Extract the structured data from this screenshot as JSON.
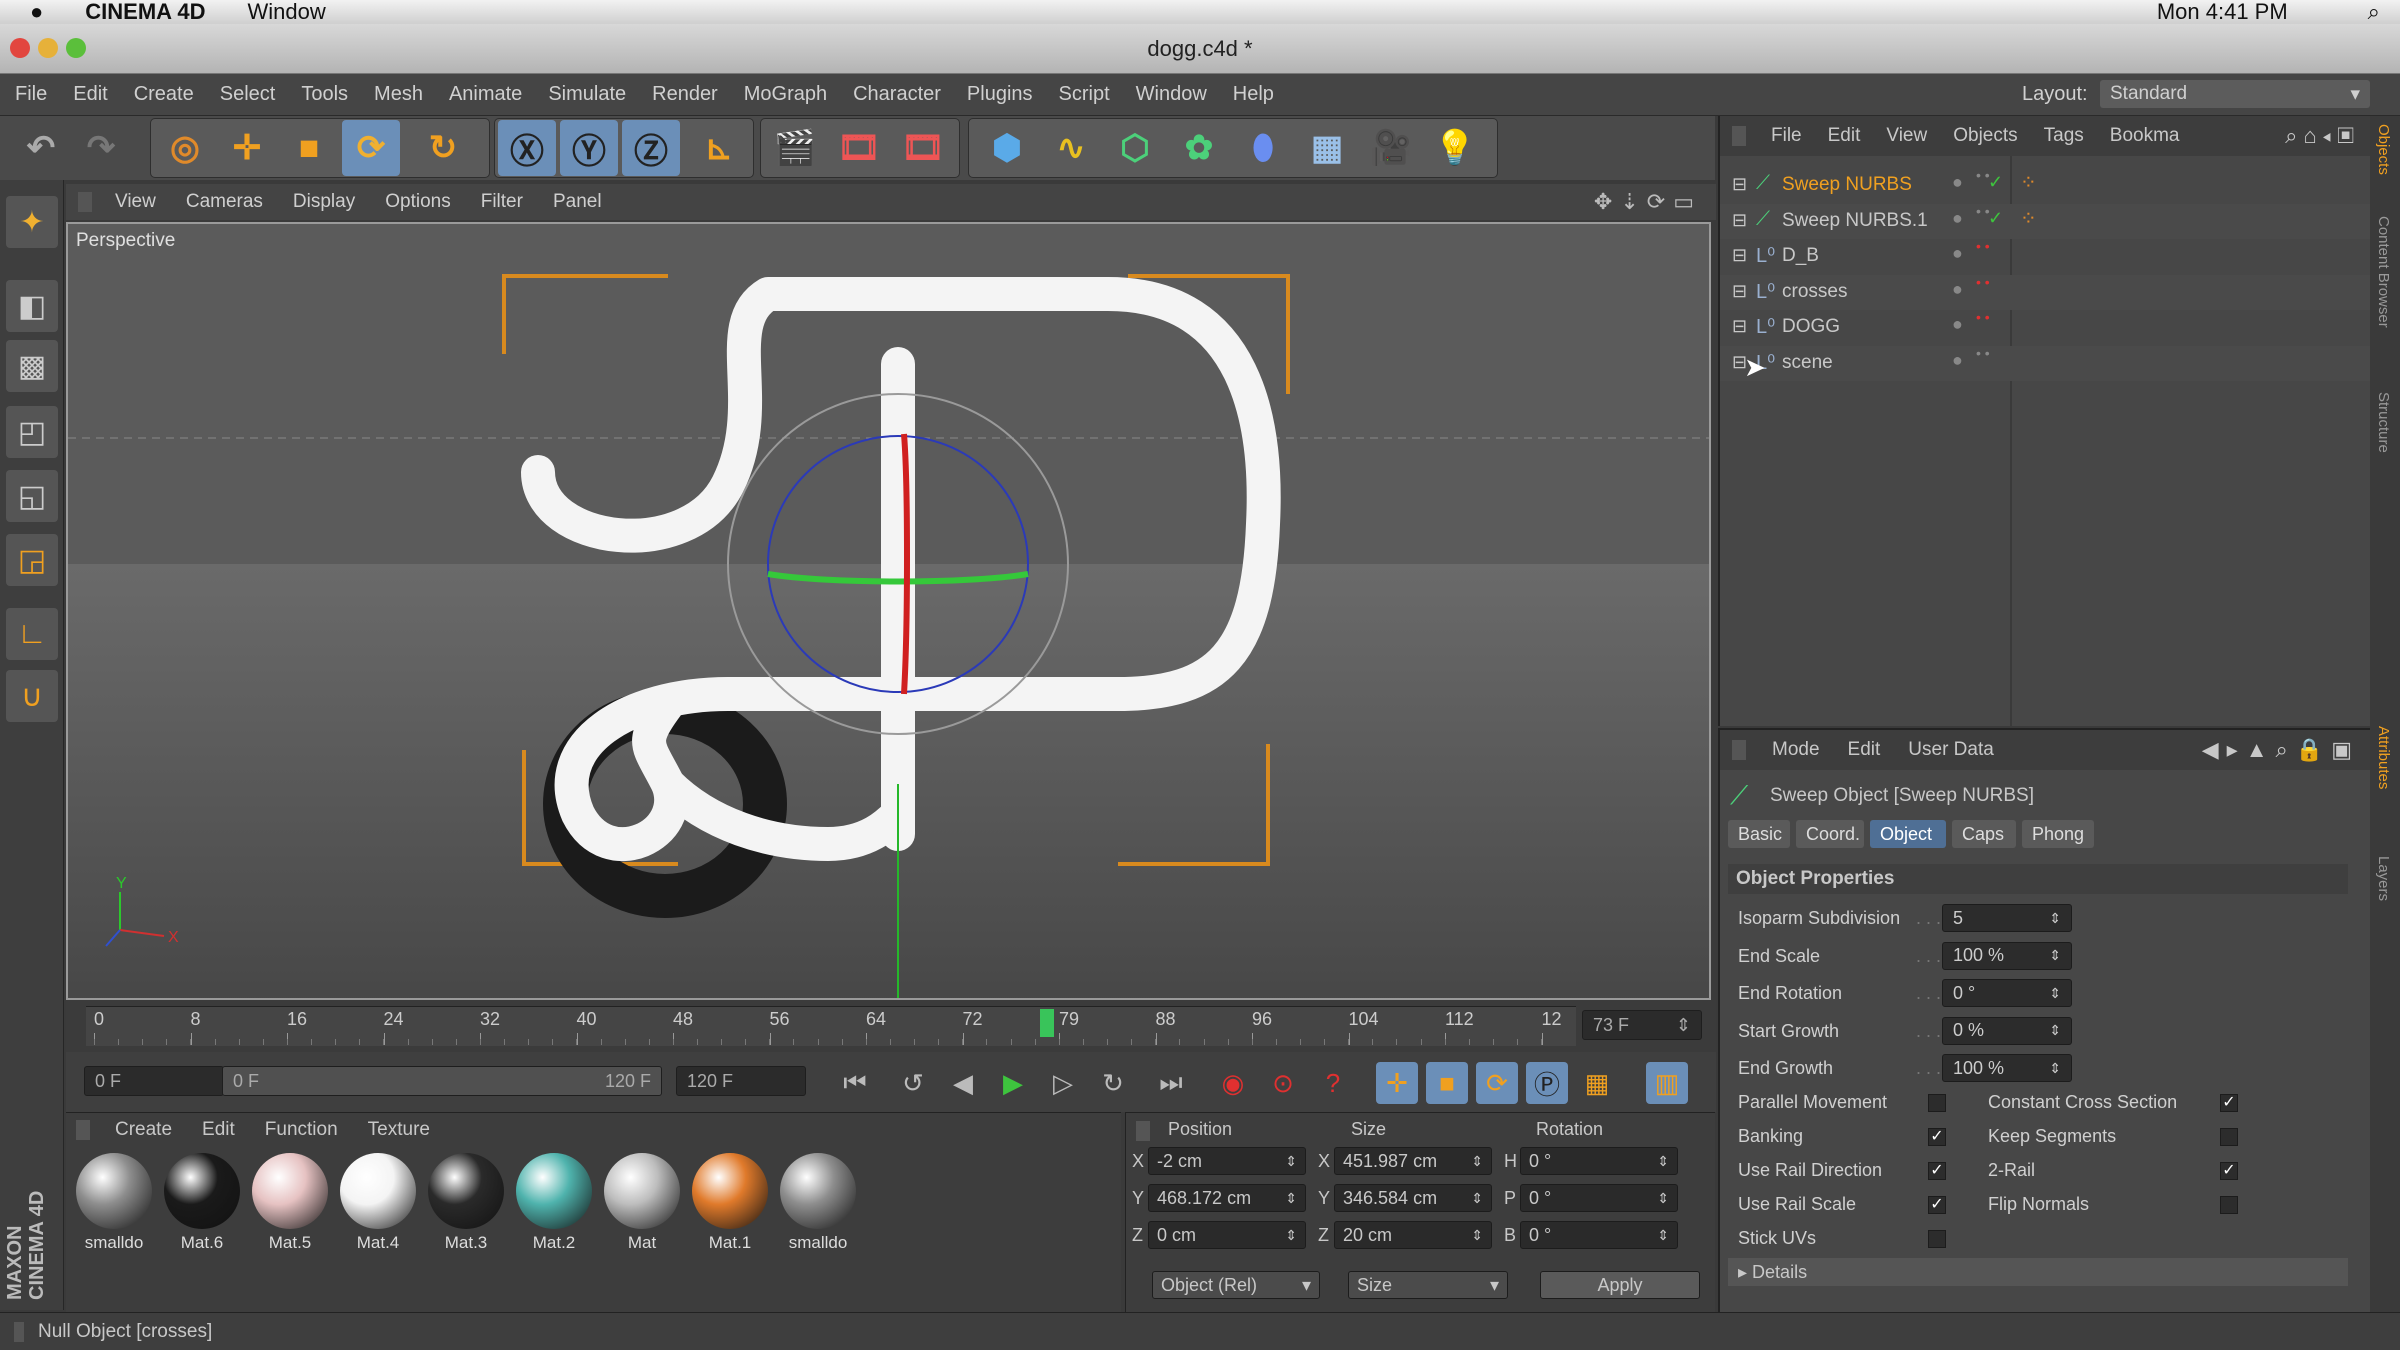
{
  "macbar": {
    "app": "CINEMA 4D",
    "window": "Window",
    "clock": "Mon 4:41 PM"
  },
  "window": {
    "title": "dogg.c4d *"
  },
  "menu": [
    "File",
    "Edit",
    "Create",
    "Select",
    "Tools",
    "Mesh",
    "Animate",
    "Simulate",
    "Render",
    "MoGraph",
    "Character",
    "Plugins",
    "Script",
    "Window",
    "Help"
  ],
  "layout": {
    "label": "Layout:",
    "value": "Standard"
  },
  "viewport": {
    "menu": [
      "View",
      "Cameras",
      "Display",
      "Options",
      "Filter",
      "Panel"
    ],
    "label": "Perspective"
  },
  "timeline": {
    "ticks": [
      "0",
      "8",
      "16",
      "24",
      "32",
      "40",
      "48",
      "56",
      "64",
      "72",
      "79",
      "88",
      "96",
      "104",
      "112",
      "12"
    ],
    "current": "73 F",
    "playhead_frame": 79,
    "max_frame": 120
  },
  "transport": {
    "start": "0 F",
    "range_start": "0 F",
    "range_end": "120 F",
    "end": "120 F"
  },
  "materials": {
    "menu": [
      "Create",
      "Edit",
      "Function",
      "Texture"
    ],
    "items": [
      {
        "name": "smalldo",
        "color": "#8e8e8e"
      },
      {
        "name": "Mat.6",
        "color": "#1a1a1a"
      },
      {
        "name": "Mat.5",
        "color": "#e6c2c2"
      },
      {
        "name": "Mat.4",
        "color": "#f4f4f4"
      },
      {
        "name": "Mat.3",
        "color": "#2a2a2a"
      },
      {
        "name": "Mat.2",
        "color": "#4fb3ad"
      },
      {
        "name": "Mat",
        "color": "#bdbdbd"
      },
      {
        "name": "Mat.1",
        "color": "#e07a2b"
      },
      {
        "name": "smalldo",
        "color": "#8e8e8e"
      }
    ]
  },
  "coords": {
    "headers": [
      "Position",
      "Size",
      "Rotation"
    ],
    "pos": [
      {
        "k": "X",
        "v": "-2 cm"
      },
      {
        "k": "Y",
        "v": "468.172 cm"
      },
      {
        "k": "Z",
        "v": "0 cm"
      }
    ],
    "size": [
      {
        "k": "X",
        "v": "451.987 cm"
      },
      {
        "k": "Y",
        "v": "346.584 cm"
      },
      {
        "k": "Z",
        "v": "20 cm"
      }
    ],
    "rot": [
      {
        "k": "H",
        "v": "0 °"
      },
      {
        "k": "P",
        "v": "0 °"
      },
      {
        "k": "B",
        "v": "0 °"
      }
    ],
    "mode": "Object (Rel)",
    "sizemode": "Size",
    "apply": "Apply"
  },
  "objects": {
    "menu": [
      "File",
      "Edit",
      "View",
      "Objects",
      "Tags",
      "Bookma"
    ],
    "rows": [
      {
        "name": "Sweep NURBS",
        "selected": true
      },
      {
        "name": "Sweep NURBS.1",
        "selected": false
      },
      {
        "name": "D_B",
        "selected": false
      },
      {
        "name": "crosses",
        "selected": false
      },
      {
        "name": "DOGG",
        "selected": false
      },
      {
        "name": "scene",
        "selected": false
      }
    ]
  },
  "attributes": {
    "menu": [
      "Mode",
      "Edit",
      "User Data"
    ],
    "object_title": "Sweep Object [Sweep NURBS]",
    "tabs": [
      "Basic",
      "Coord.",
      "Object",
      "Caps",
      "Phong"
    ],
    "active_tab": "Object",
    "section": "Object Properties",
    "props": [
      {
        "label": "Isoparm Subdivision",
        "value": "5"
      },
      {
        "label": "End Scale",
        "value": "100 %"
      },
      {
        "label": "End Rotation",
        "value": "0 °"
      },
      {
        "label": "Start Growth",
        "value": "0 %"
      },
      {
        "label": "End Growth",
        "value": "100 %"
      }
    ],
    "checks_left": [
      {
        "label": "Parallel Movement",
        "checked": false
      },
      {
        "label": "Banking",
        "checked": true
      },
      {
        "label": "Use Rail Direction",
        "checked": true
      },
      {
        "label": "Use Rail Scale",
        "checked": true
      },
      {
        "label": "Stick UVs",
        "checked": false
      }
    ],
    "checks_right": [
      {
        "label": "Constant Cross Section",
        "checked": true
      },
      {
        "label": "Keep Segments",
        "checked": false
      },
      {
        "label": "2-Rail",
        "checked": true
      },
      {
        "label": "Flip Normals",
        "checked": false
      }
    ],
    "details": "Details"
  },
  "side_tabs": [
    "Objects",
    "Content Browser",
    "Structure",
    "Attributes",
    "Layers"
  ],
  "status": "Null Object [crosses]",
  "brand": "MAXON CINEMA 4D"
}
